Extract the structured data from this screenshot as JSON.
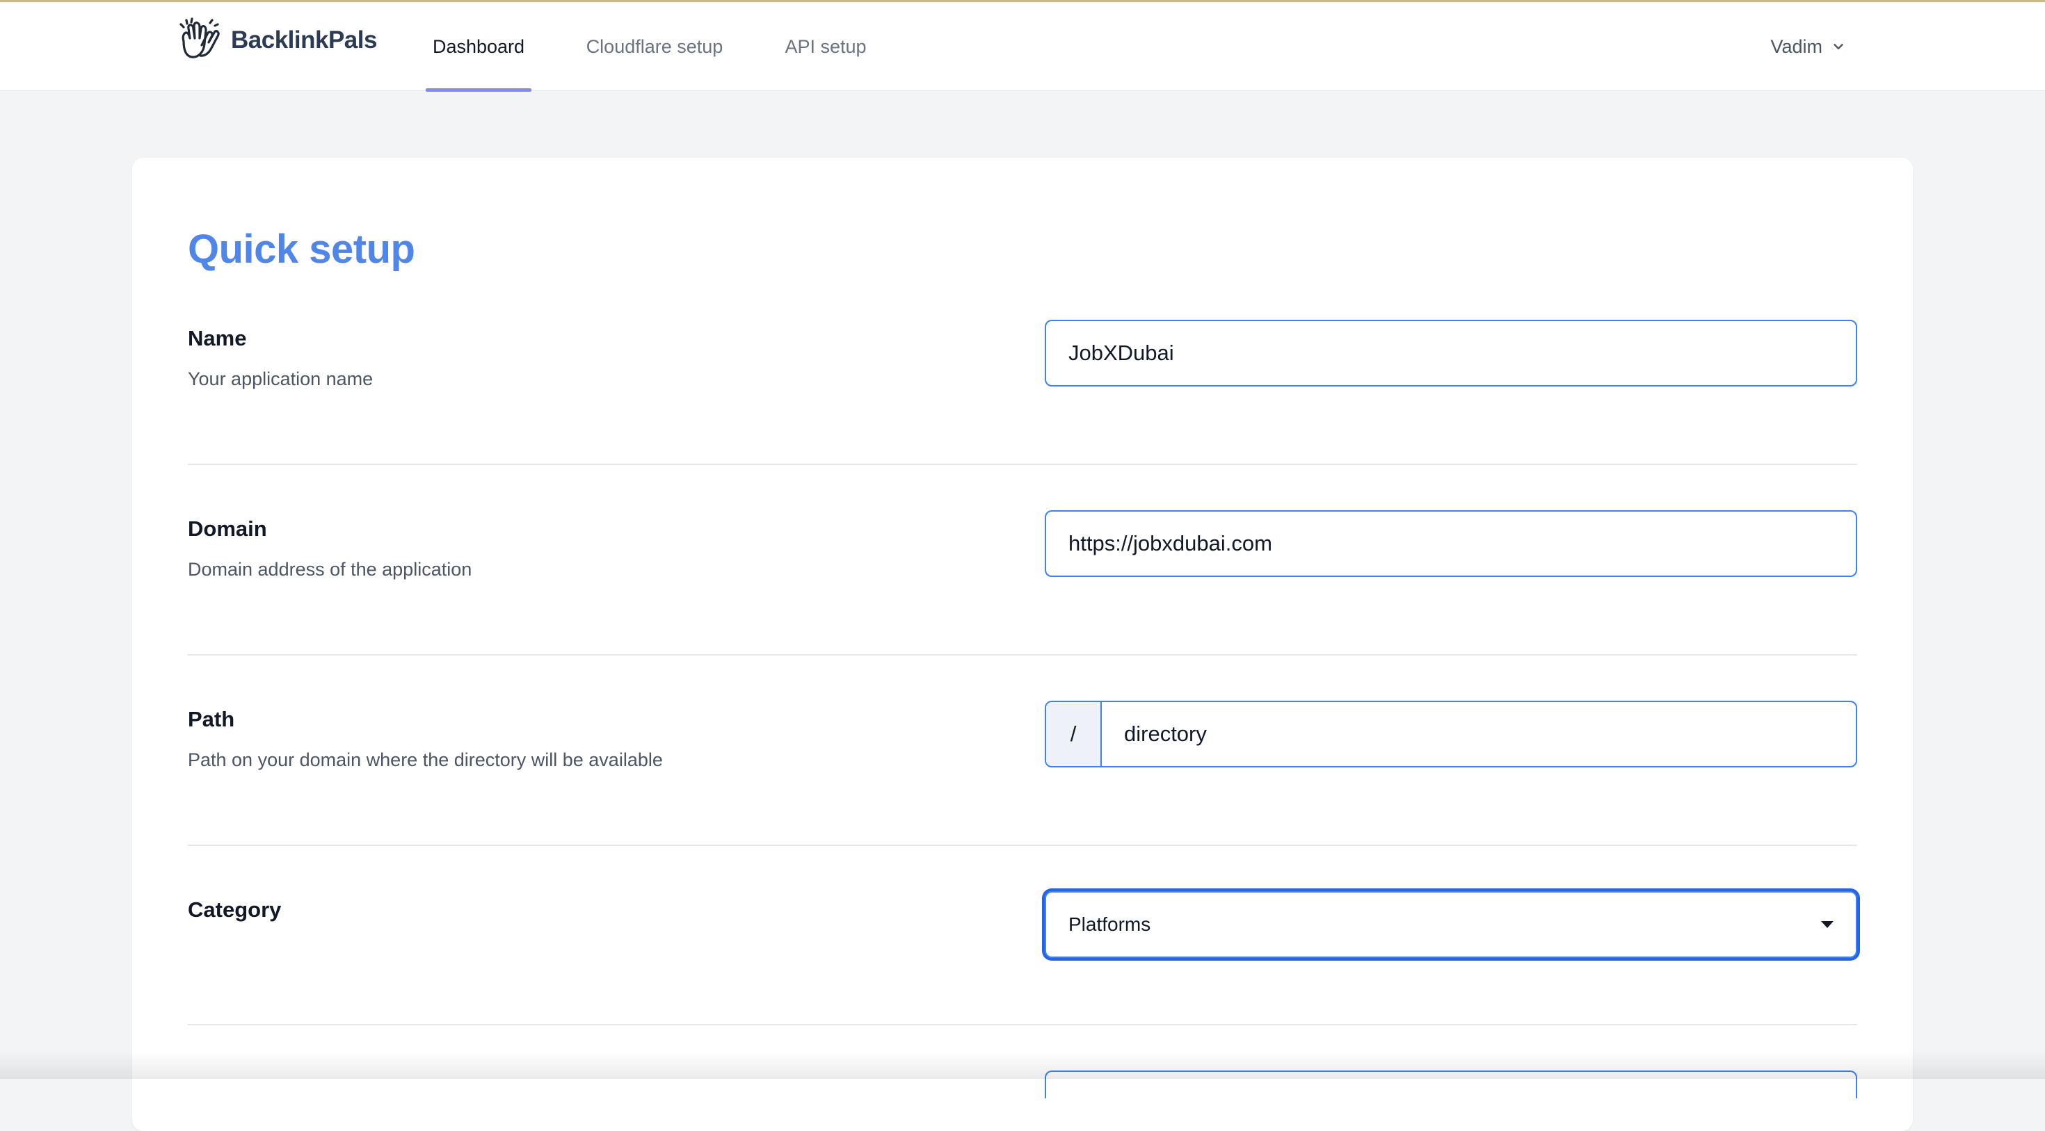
{
  "brand": {
    "name": "BacklinkPals",
    "logo_icon": "waving-hands-icon"
  },
  "nav": {
    "tabs": [
      {
        "label": "Dashboard",
        "active": true
      },
      {
        "label": "Cloudflare setup",
        "active": false
      },
      {
        "label": "API setup",
        "active": false
      }
    ],
    "user": {
      "name": "Vadim",
      "icon": "chevron-down-icon"
    }
  },
  "form": {
    "title": "Quick setup",
    "name": {
      "label": "Name",
      "hint": "Your application name",
      "value": "JobXDubai"
    },
    "domain": {
      "label": "Domain",
      "hint": "Domain address of the application",
      "value": "https://jobxdubai.com"
    },
    "path": {
      "label": "Path",
      "hint": "Path on your domain where the directory will be available",
      "prefix": "/",
      "value": "directory"
    },
    "category": {
      "label": "Category",
      "value": "Platforms"
    }
  },
  "colors": {
    "accent": "#4f86e8",
    "field_border": "#3b82f6",
    "nav_underline": "#818cf8",
    "page_bg": "#f3f4f6"
  }
}
